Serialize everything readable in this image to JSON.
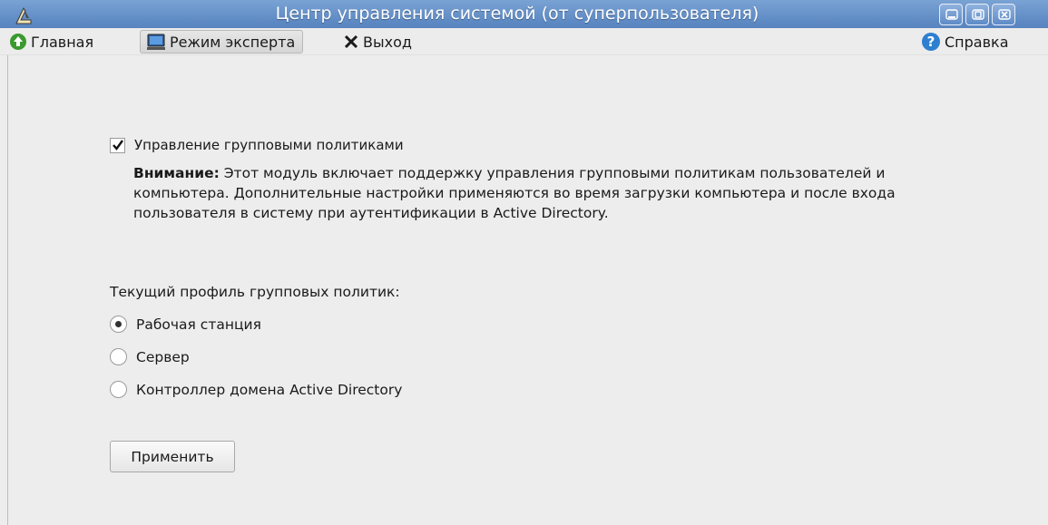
{
  "window": {
    "title": "Центр управления системой (от суперпользователя)",
    "controls": [
      "minimize-icon",
      "maximize-icon",
      "close-icon"
    ]
  },
  "toolbar": {
    "home_label": "Главная",
    "expert_label": "Режим эксперта",
    "exit_label": "Выход",
    "help_label": "Справка"
  },
  "module": {
    "checkbox_label": "Управление групповыми политиками",
    "checkbox_checked": true,
    "warning_title": "Внимание:",
    "warning_text": "Этот модуль включает поддержку управления групповыми политикам пользователей и компьютера. Дополнительные настройки применяются во время загрузки компьютера и после входа пользователя в систему при аутентификации в Active Directory.",
    "profile_label": "Текущий профиль групповых политик:",
    "profiles": [
      {
        "label": "Рабочая станция",
        "selected": true
      },
      {
        "label": "Сервер",
        "selected": false
      },
      {
        "label": "Контроллер домена Active Directory",
        "selected": false
      }
    ],
    "apply_label": "Применить"
  },
  "colors": {
    "titlebar": "#5b87c2",
    "toolbar_bg": "#ececec",
    "content_bg": "#ededed",
    "home_icon": "#3a9a2e",
    "help_icon": "#2f7fd0"
  }
}
